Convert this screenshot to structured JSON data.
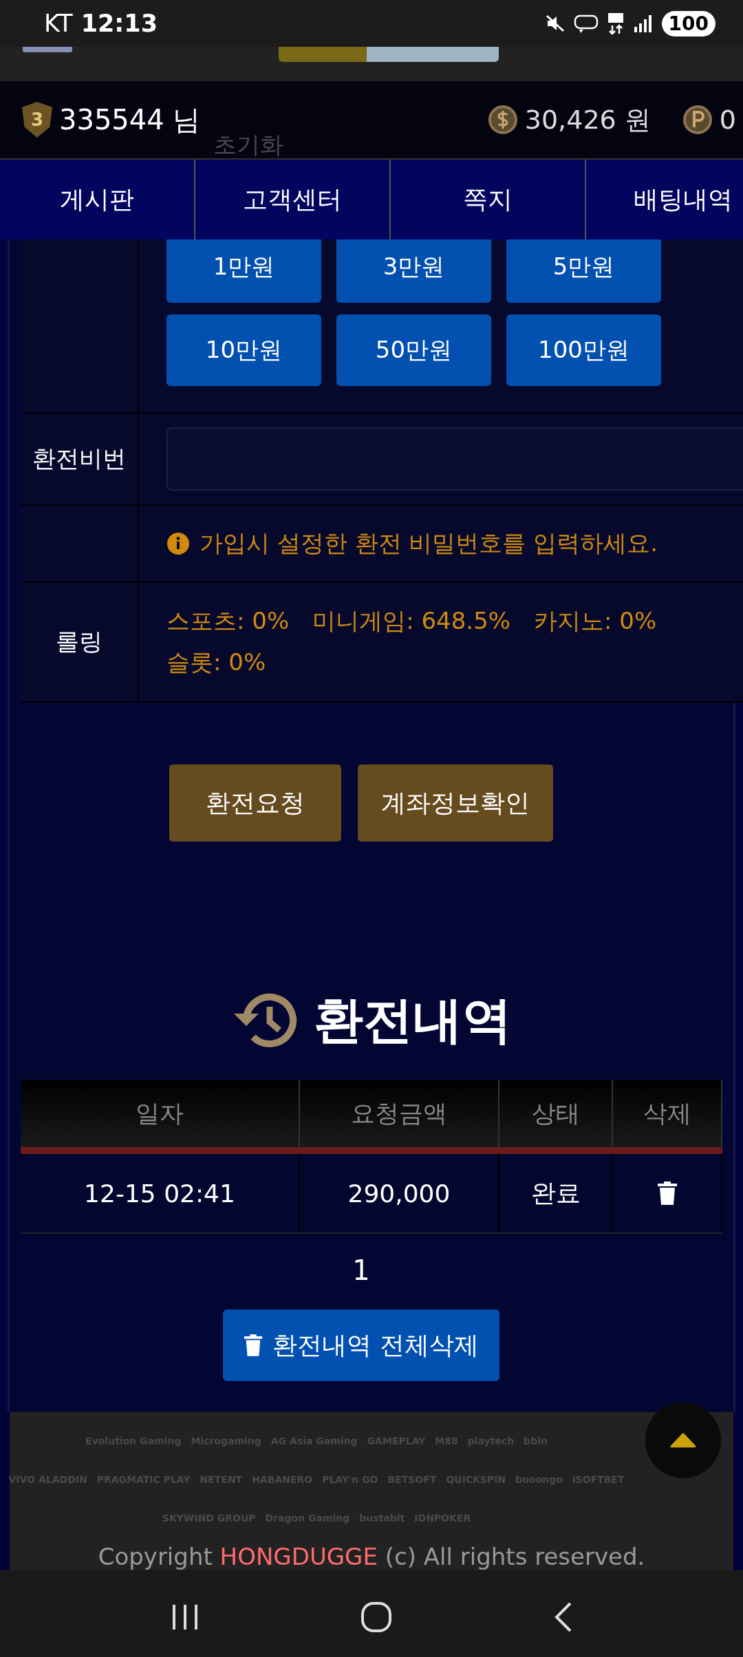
{
  "status_bar": {
    "carrier": "KT",
    "time": "12:13",
    "battery": "100"
  },
  "user_bar": {
    "level": "3",
    "name": "335544 님",
    "behind_text": "초기화",
    "balance": "30,426 원",
    "points": "0"
  },
  "nav_tabs": [
    {
      "label": "게시판"
    },
    {
      "label": "고객센터"
    },
    {
      "label": "쪽지"
    },
    {
      "label": "배팅내역"
    }
  ],
  "amount_buttons": [
    "1만원",
    "3만원",
    "5만원",
    "10만원",
    "50만원",
    "100만원"
  ],
  "form": {
    "password_label": "환전비번",
    "notice": "가입시 설정한 환전 비밀번호를 입력하세요.",
    "rolling_label": "롤링",
    "rolling": [
      "스포츠: 0%",
      "미니게임: 648.5%",
      "카지노: 0%",
      "슬롯: 0%"
    ]
  },
  "actions": [
    "환전요청",
    "계좌정보확인"
  ],
  "history": {
    "title": "환전내역",
    "columns": [
      "일자",
      "요청금액",
      "상태",
      "삭제"
    ],
    "rows": [
      {
        "date": "12-15 02:41",
        "amount": "290,000",
        "status": "완료"
      }
    ],
    "pages": [
      "1"
    ],
    "delete_all": "환전내역 전체삭제"
  },
  "footer": {
    "providers": [
      [
        "Evolution Gaming",
        "Microgaming",
        "AG Asia Gaming",
        "GAMEPLAY",
        "M88",
        "playtech",
        "bbin"
      ],
      [
        "VIVO ALADDIN",
        "PRAGMATIC PLAY",
        "NETENT",
        "HABANERO",
        "PLAY'n GO",
        "BETSOFT",
        "QUICKSPIN",
        "booongo",
        "iSOFTBET"
      ],
      [
        "SKYWIND GROUP",
        "Dragon Gaming",
        "bustabit",
        "IDNPOKER"
      ]
    ],
    "copyright_prefix": "Copyright",
    "brand": "HONGDUGGE",
    "copyright_suffix": "(c) All rights reserved."
  }
}
